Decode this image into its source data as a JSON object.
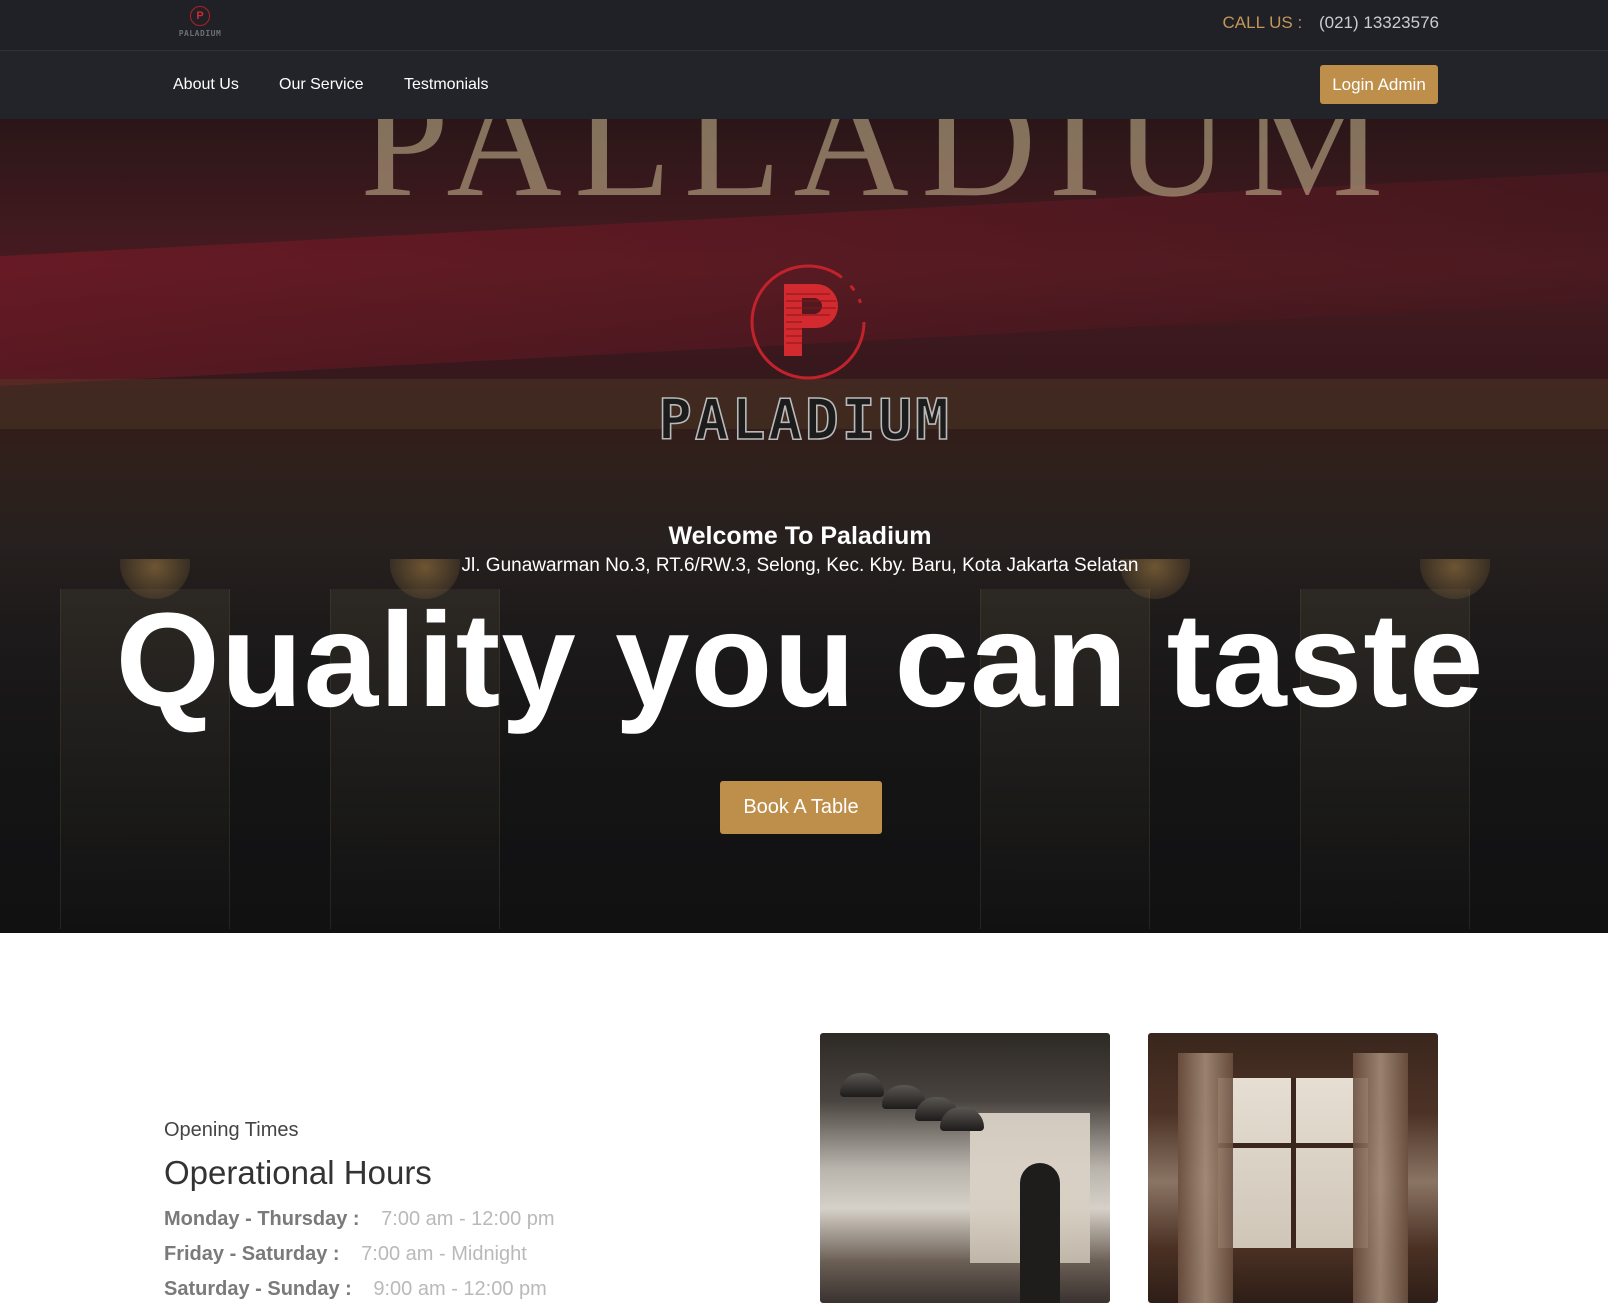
{
  "topbar": {
    "logo_text": "PALADIUM",
    "call_label": "CALL US :",
    "phone": "(021) 13323576"
  },
  "nav": {
    "items": [
      {
        "label": "About Us"
      },
      {
        "label": "Our Service"
      },
      {
        "label": "Testmonials"
      }
    ],
    "login_label": "Login Admin"
  },
  "hero": {
    "sign_text": "PALLADIUM",
    "logo_letter": "P",
    "logo_word": "PALADIUM",
    "welcome": "Welcome To Paladium",
    "address": "Jl. Gunawarman No.3, RT.6/RW.3, Selong, Kec. Kby. Baru, Kota Jakarta Selatan",
    "headline": "Quality you can taste",
    "book_label": "Book A Table"
  },
  "opening": {
    "subtitle": "Opening Times",
    "title": "Operational Hours",
    "rows": [
      {
        "day": "Monday - Thursday :",
        "time": "7:00 am - 12:00 pm"
      },
      {
        "day": "Friday - Saturday :",
        "time": "7:00 am - Midnight"
      },
      {
        "day": "Saturday - Sunday :",
        "time": "9:00 am - 12:00 pm"
      }
    ]
  },
  "colors": {
    "accent": "#be8e4b",
    "topbar_bg": "#1f2127",
    "nav_bg": "#22242a",
    "brand_red": "#d22a2f"
  }
}
